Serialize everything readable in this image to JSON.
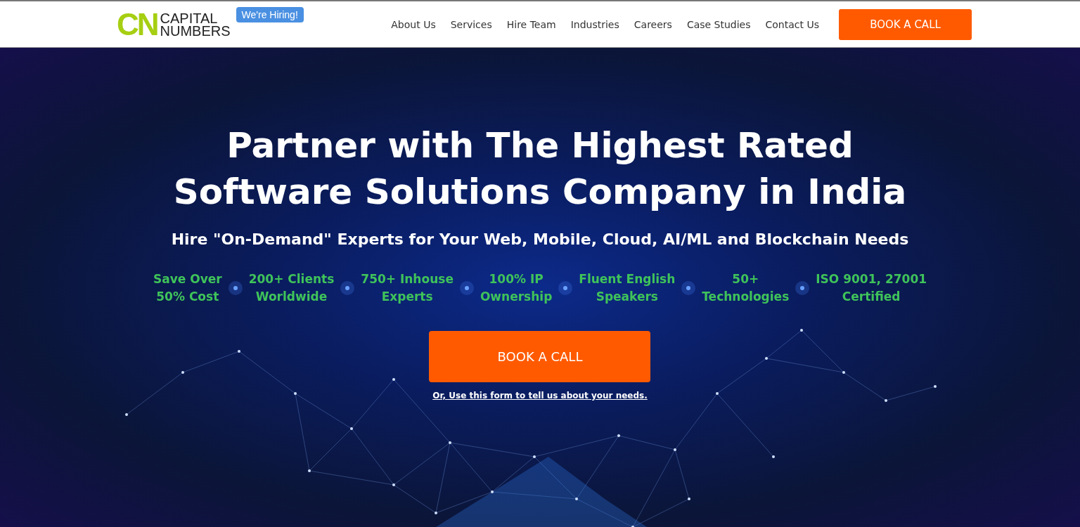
{
  "header": {
    "logo": {
      "mark": "CN",
      "line_1": "CAPITAL",
      "line_2": "NUMBERS"
    },
    "badge": "We're Hiring!",
    "nav": [
      "About Us",
      "Services",
      "Hire Team",
      "Industries",
      "Careers",
      "Case Studies",
      "Contact Us"
    ],
    "cta": "BOOK A CALL"
  },
  "hero": {
    "title_line_1": "Partner with The Highest Rated",
    "title_line_2": "Software Solutions Company in India",
    "subtitle": "Hire \"On-Demand\" Experts for Your Web, Mobile, Cloud, AI/ML and Blockchain Needs",
    "stats": [
      {
        "line_1": "Save Over",
        "line_2": "50% Cost"
      },
      {
        "line_1": "200+ Clients",
        "line_2": "Worldwide"
      },
      {
        "line_1": "750+ Inhouse",
        "line_2": "Experts"
      },
      {
        "line_1": "100% IP",
        "line_2": "Ownership"
      },
      {
        "line_1": "Fluent English",
        "line_2": "Speakers"
      },
      {
        "line_1": "50+",
        "line_2": "Technologies"
      },
      {
        "line_1": "ISO 9001, 27001",
        "line_2": "Certified"
      }
    ],
    "cta": "BOOK A CALL",
    "form_link": "Or, Use this form to tell us about your needs."
  }
}
